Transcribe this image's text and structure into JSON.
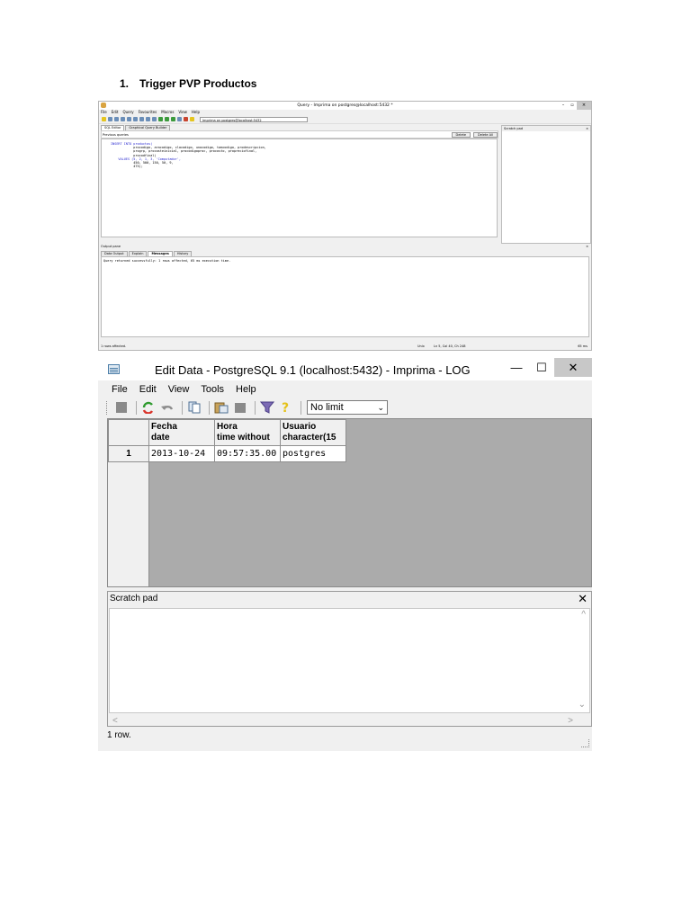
{
  "doc": {
    "list_number": "1.",
    "heading": "Trigger PVP Productos"
  },
  "query_window": {
    "title": "Query - Imprima on postgres@localhost:5432 *",
    "menu": [
      "File",
      "Edit",
      "Query",
      "Favourites",
      "Macros",
      "View",
      "Help"
    ],
    "connection": "Imprima on postgres@localhost:5432",
    "tabs": [
      "SQL Editor",
      "Graphical Query Builder"
    ],
    "previous_queries_label": "Previous queries",
    "delete_label": "Delete",
    "delete_all_label": "Delete All",
    "scratch_pad_label": "Scratch pad",
    "sql_lines": [
      "INSERT INTO productos(",
      "            procodigo, aracodigo, clacodigo, unocodigo, tamcodigo, prodescripcion,",
      "            progrp, procosteinicial, procodigoproc, procosto, propreciofinal,",
      "            procodfinal)",
      "    VALUES (5, 2, 1, 3, 'Computador',",
      "            450, 500, 150, 50, 9,",
      "            475);"
    ],
    "output_pane_label": "Output pane",
    "output_tabs": [
      "Data Output",
      "Explain",
      "Messages",
      "History"
    ],
    "message": "Query returned successfully: 1 rows affected, 65 ms execution time.",
    "status_left": "1 rows affected.",
    "status_mode": "Unix",
    "status_pos": "Ln 5, Col 40, Ch 248",
    "status_time": "65 ms"
  },
  "edit_window": {
    "title": "Edit Data - PostgreSQL 9.1 (localhost:5432) - Imprima - LOG",
    "menu": [
      "File",
      "Edit",
      "View",
      "Tools",
      "Help"
    ],
    "limit_value": "No limit",
    "columns": [
      {
        "name": "Fecha",
        "type": "date"
      },
      {
        "name": "Hora",
        "type": "time without"
      },
      {
        "name": "Usuario",
        "type": "character(15"
      }
    ],
    "rows": [
      {
        "num": "1",
        "cells": [
          "2013-10-24",
          "09:57:35.00",
          "postgres"
        ]
      }
    ],
    "scratch_pad_label": "Scratch pad",
    "status": "1 row."
  }
}
